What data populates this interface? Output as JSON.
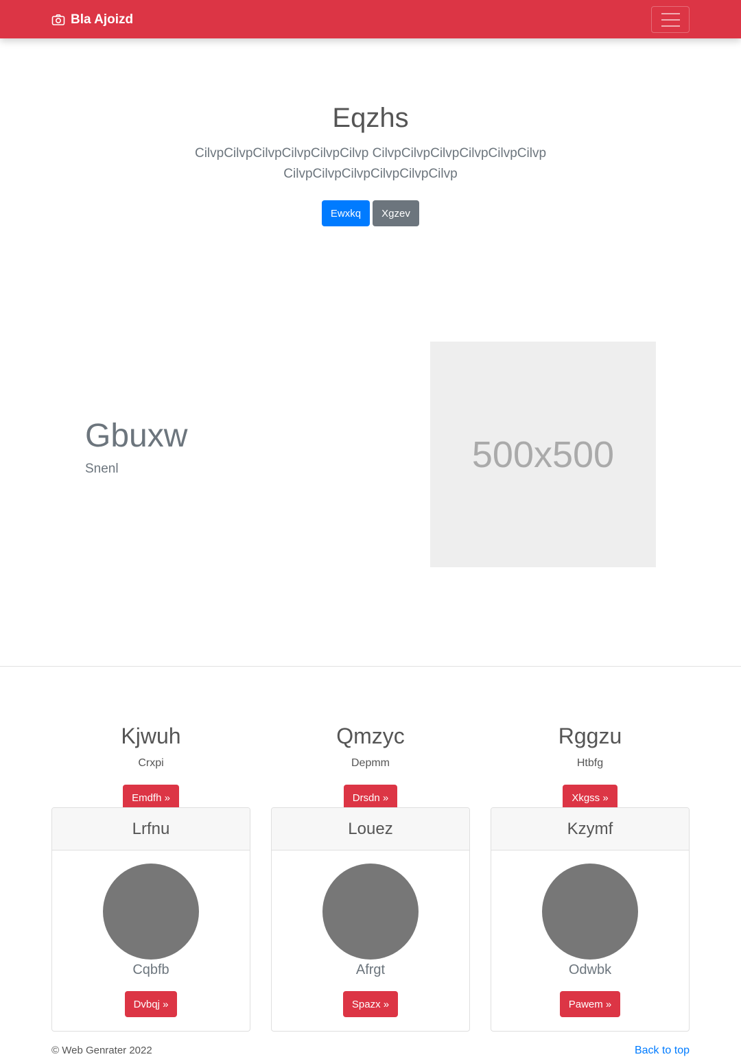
{
  "navbar": {
    "brand": "Bla Ajoizd",
    "brand_icon": "camera-icon",
    "color": "#dc3545"
  },
  "hero": {
    "title": "Eqzhs",
    "lead": "CilvpCilvpCilvpCilvpCilvpCilvp CilvpCilvpCilvpCilvpCilvpCilvp CilvpCilvpCilvpCilvpCilvpCilvp",
    "primary_button": "Ewxkq",
    "secondary_button": "Xgzev"
  },
  "feature": {
    "heading": "Gbuxw",
    "subheading": "Snenl",
    "image_label": "500x500"
  },
  "columns": [
    {
      "title": "Kjwuh",
      "text": "Crxpi",
      "button": "Emdfh »"
    },
    {
      "title": "Qmzyc",
      "text": "Depmm",
      "button": "Drsdn »"
    },
    {
      "title": "Rggzu",
      "text": "Htbfg",
      "button": "Xkgss »"
    }
  ],
  "cards": [
    {
      "header": "Lrfnu",
      "name": "Cqbfb",
      "button": "Dvbqj »"
    },
    {
      "header": "Louez",
      "name": "Afrgt",
      "button": "Spazx »"
    },
    {
      "header": "Kzymf",
      "name": "Odwbk",
      "button": "Pawem »"
    }
  ],
  "footer": {
    "copyright": "© Web Genrater 2022",
    "back_to_top": "Back to top"
  }
}
